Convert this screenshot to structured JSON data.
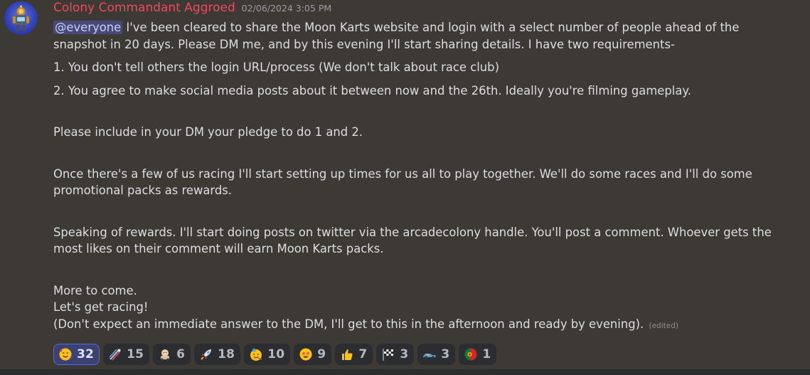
{
  "message": {
    "author": "Colony Commandant Aggroed",
    "timestamp": "02/06/2024 3:05 PM",
    "mention": "@everyone",
    "lines": {
      "l1_rest": " I've been cleared to share the Moon Karts website and login with a select number of people ahead of the",
      "l2": "snapshot in 20 days.  Please DM me, and by this evening I'll start sharing details.  I have two requirements-",
      "l3": "1. You don't tell others the login URL/process (We don't talk about race club)",
      "l4": "2. You agree to make social media posts about it between now and the 26th.  Ideally you're filming gameplay.",
      "l5": "Please include in your DM your pledge to do 1 and 2.",
      "l6": "Once there's a few of us racing I'll start setting up times for us all to play together.  We'll do some races and I'll do some",
      "l7": "promotional packs as rewards.",
      "l8": "Speaking of rewards.  I'll start doing posts on twitter via the arcadecolony handle.  You'll post a comment.  Whoever gets the",
      "l9": "most likes on their comment will earn Moon Karts packs.",
      "l10": "More to come.",
      "l11": "Let's get racing!",
      "l12": "(Don't expect an immediate answer to the DM, I'll get to this in the afternoon and ready by evening)."
    },
    "edited_label": "(edited)"
  },
  "reactions": [
    {
      "emoji": "smiling-face-with-hearts-icon",
      "count": "32",
      "selected": true
    },
    {
      "emoji": "rocket-streak-icon",
      "count": "15",
      "selected": false
    },
    {
      "emoji": "kart-character-icon",
      "count": "6",
      "selected": false
    },
    {
      "emoji": "rocket-icon",
      "count": "18",
      "selected": false
    },
    {
      "emoji": "party-face-icon",
      "count": "10",
      "selected": false
    },
    {
      "emoji": "star-struck-icon",
      "count": "9",
      "selected": false
    },
    {
      "emoji": "thumbs-up-icon",
      "count": "7",
      "selected": false
    },
    {
      "emoji": "checkered-flag-icon",
      "count": "3",
      "selected": false
    },
    {
      "emoji": "race-car-icon",
      "count": "3",
      "selected": false
    },
    {
      "emoji": "portugal-flag-icon",
      "count": "1",
      "selected": false
    }
  ],
  "colors": {
    "background": "#3d3a35",
    "author": "#f0475f",
    "mention_bg": "#464a75",
    "reaction_selected_border": "#5865f2"
  }
}
